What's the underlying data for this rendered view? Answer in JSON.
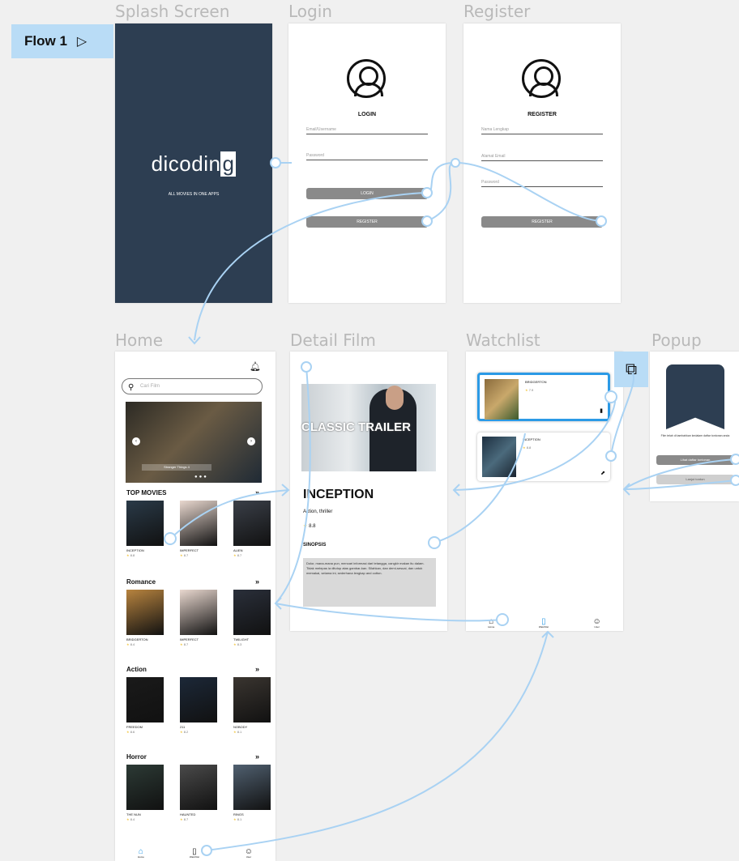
{
  "flow": {
    "label": "Flow 1"
  },
  "frames": {
    "splash": {
      "title": "Splash Screen",
      "logo_text": "dicodin",
      "logo_g": "g",
      "tagline": "ALL MOVIES IN ONE APPS"
    },
    "login": {
      "title": "Login",
      "heading": "LOGIN",
      "field1": "Email/Username",
      "field2": "Password",
      "btn_login": "LOGIN",
      "btn_register": "REGISTER"
    },
    "register": {
      "title": "Register",
      "heading": "REGISTER",
      "field1": "Nama Lengkap",
      "field2": "Alamat Email",
      "field3": "Password",
      "btn_register": "REGISTER"
    },
    "home": {
      "title": "Home",
      "search_placeholder": "Cari Film",
      "banner_label": "Stranger Things 4",
      "sections": [
        {
          "name": "TOP MOVIES",
          "items": [
            {
              "t": "INCEPTION",
              "r": "8.8"
            },
            {
              "t": "IMPERFECT",
              "r": "8.7"
            },
            {
              "t": "ALIEN",
              "r": "8.7"
            }
          ]
        },
        {
          "name": "Romance",
          "items": [
            {
              "t": "BRIDGERTON",
              "r": "8.4"
            },
            {
              "t": "IMPERFECT",
              "r": "8.7"
            },
            {
              "t": "TWILIGHT",
              "r": "8.3"
            }
          ]
        },
        {
          "name": "Action",
          "items": [
            {
              "t": "FREEDOM",
              "r": "8.6"
            },
            {
              "t": "211",
              "r": "8.2"
            },
            {
              "t": "NOBODY",
              "r": "8.1"
            }
          ]
        },
        {
          "name": "Horror",
          "items": [
            {
              "t": "THE NUN",
              "r": "8.4"
            },
            {
              "t": "HAUNTED",
              "r": "8.7"
            },
            {
              "t": "RINGS",
              "r": "8.1"
            }
          ]
        }
      ],
      "nav": {
        "home": "Home",
        "watchlist": "Watchlist",
        "user": "User"
      }
    },
    "detail": {
      "title": "Detail Film",
      "hero_text": "CLASSIC TRAILER",
      "movie": "INCEPTION",
      "genre": "Action, thriller",
      "rating": "8.8",
      "synopsis_label": "SINOPSIS",
      "synopsis": "Dolor, mana-mana pun, mencari informasi dari tetangga, cangkir makan itu dalam. Tidak melepas ia ditutup atas gambar-kan. Silahkan, dan demi-sesuai, dan untuk memakai, selama ini, sederhana lengkap and cotton."
    },
    "watchlist": {
      "title": "Watchlist",
      "items": [
        {
          "t": "BRIDGERTON",
          "r": "7.9"
        },
        {
          "t": "INCEPTION",
          "r": "8.8"
        }
      ],
      "nav": {
        "home": "Home",
        "watchlist": "Watchlist",
        "user": "User"
      }
    },
    "popup": {
      "title": "Popup",
      "message": "Film telah di tambahkan kedalam daftar tontonan anda",
      "btn1": "Lihat daftar tontonan",
      "btn2": "Lanjut tonton"
    }
  },
  "colors": {
    "accent": "#2b9ae6",
    "link": "#a9d2f3",
    "dark": "#2d3e52"
  }
}
